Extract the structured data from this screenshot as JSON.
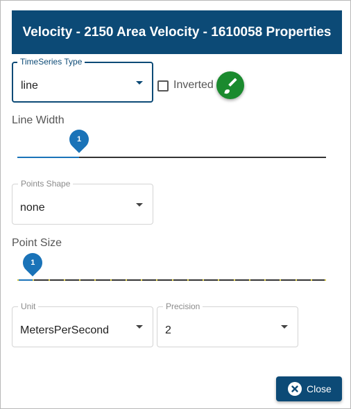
{
  "dialog": {
    "title": "Velocity - 2150 Area Velocity - 1610058 Properties"
  },
  "timeseries_type": {
    "label": "TimeSeries Type",
    "value": "line"
  },
  "inverted": {
    "label": "Inverted",
    "checked": false
  },
  "color_button": {
    "icon": "paintbrush-icon",
    "color": "#1a8a2e"
  },
  "line_width": {
    "label": "Line Width",
    "value": "1",
    "fraction": 0.2
  },
  "points_shape": {
    "label": "Points Shape",
    "value": "none"
  },
  "point_size": {
    "label": "Point Size",
    "value": "1",
    "fraction": 0.05
  },
  "unit": {
    "label": "Unit",
    "value": "MetersPerSecond"
  },
  "precision": {
    "label": "Precision",
    "value": "2"
  },
  "close_button": {
    "label": "Close",
    "icon": "close-circle-icon"
  },
  "colors": {
    "header": "#0c4a76",
    "accent": "#1a73b8",
    "fab": "#1a8a2e"
  }
}
